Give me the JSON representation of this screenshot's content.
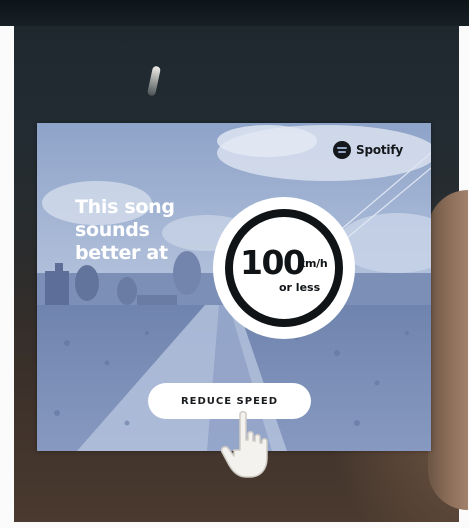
{
  "ad": {
    "brand_name": "Spotify",
    "brand_icon": "spotify-logo-icon",
    "headline": "This song\nsounds\nbetter at",
    "speed": {
      "value": "100",
      "unit": "km/h",
      "qualifier": "or less"
    },
    "cta_label": "REDUCE SPEED",
    "cursor_icon": "hand-pointer-icon"
  },
  "colors": {
    "ad_tint": "#93a6c8",
    "badge_ring": "#111417",
    "button_bg": "#ffffff"
  }
}
